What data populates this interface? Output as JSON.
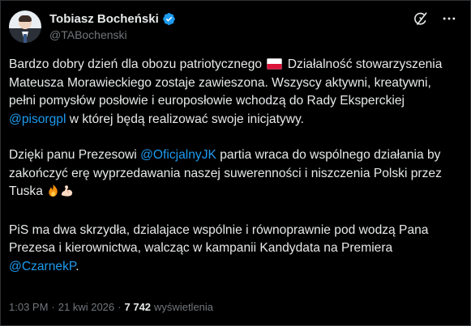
{
  "author": {
    "display_name": "Tobiasz Bocheński",
    "handle": "@TABochenski",
    "verified": true
  },
  "header_icons": [
    "grok-icon",
    "more-icon"
  ],
  "tweet": {
    "p1": {
      "t1": "Bardzo dobry dzień dla obozu patriotycznego",
      "flag": "flag-poland",
      "t2": " Działalność stowarzyszenia Mateusza Morawieckiego zostaje zawieszona. Wszyscy aktywni, kreatywni, pełni pomysłów posłowie i europosłowie wchodzą do Rady Eksperckiej ",
      "mention": "@pisorgpl",
      "t3": " w której będą realizować swoje inicjatywy."
    },
    "p2": {
      "t1": "Dzięki panu Prezesowi ",
      "mention": "@OficjalnyJK",
      "t2": " partia wraca do wspólnego działania by zakończyć erę wyprzedawania naszej suwerenności i niszczenia Polski przez Tuska ",
      "emojis": [
        "fire",
        "flexed-biceps"
      ]
    },
    "p3": {
      "t1": "PiS ma dwa skrzydła, dzialajace wspólnie i równoprawnie pod wodzą Pana Prezesa i kierownictwa, walcząc w kampanii Kandydata na Premiera ",
      "mention": "@CzarnekP",
      "t2": "."
    }
  },
  "meta": {
    "time": "1:03 PM",
    "separator": "·",
    "date": "21 kwi 2026",
    "views_count": "7 742",
    "views_label": "wyświetlenia"
  },
  "colors": {
    "background": "#000000",
    "text": "#e7e9ea",
    "muted": "#71767b",
    "link": "#1d9bf0",
    "border": "#2f3336"
  }
}
